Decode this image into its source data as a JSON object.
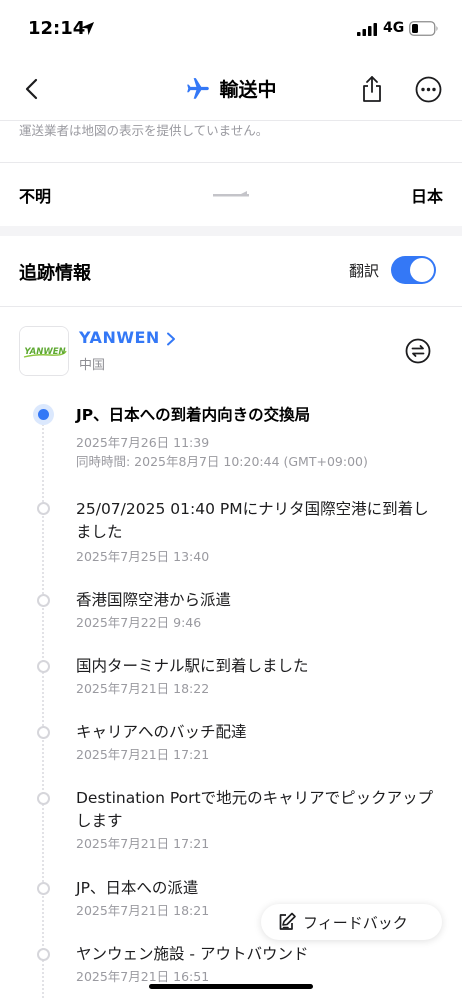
{
  "status_bar": {
    "time": "12:14",
    "network": "4G"
  },
  "nav": {
    "title": "輸送中"
  },
  "map_note": "運送業者は地図の表示を提供していません。",
  "route": {
    "from": "不明",
    "to": "日本"
  },
  "tracking": {
    "title": "追跡情報",
    "translate_label": "翻訳",
    "translate_on": true
  },
  "carrier": {
    "name": "YANWEN",
    "country": "中国",
    "logo_text": "YANWEN"
  },
  "events": [
    {
      "text": "JP、日本への到着内向きの交換局",
      "date": "2025年7月26日 11:39",
      "sync": "同時時間: 2025年8月7日 10:20:44 (GMT+09:00)",
      "active": true
    },
    {
      "text": "25/07/2025 01:40 PMにナリタ国際空港に到着しました",
      "date": "2025年7月25日 13:40"
    },
    {
      "text": "香港国際空港から派遣",
      "date": "2025年7月22日 9:46"
    },
    {
      "text": "国内ターミナル駅に到着しました",
      "date": "2025年7月21日 18:22"
    },
    {
      "text": "キャリアへのバッチ配達",
      "date": "2025年7月21日 17:21"
    },
    {
      "text": "Destination Portで地元のキャリアでピックアップします",
      "date": "2025年7月21日 17:21"
    },
    {
      "text": "JP、日本への派遣",
      "date": "2025年7月21日 18:21"
    },
    {
      "text": "ヤンウェン施設 - アウトバウンド",
      "date": "2025年7月21日 16:51"
    }
  ],
  "feedback": {
    "label": "フィードバック"
  },
  "colors": {
    "accent": "#3478f6",
    "muted": "#9a9aa0"
  }
}
